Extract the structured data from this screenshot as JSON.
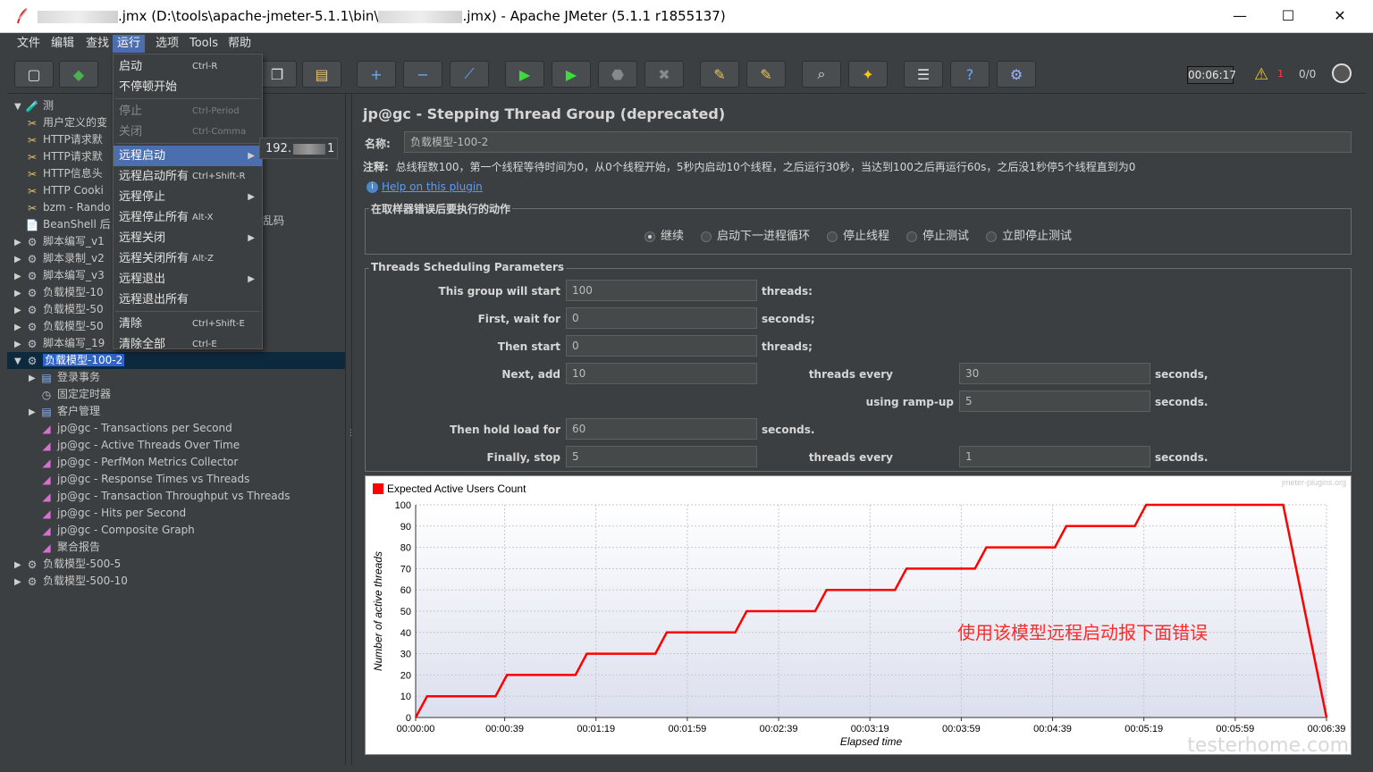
{
  "window": {
    "title_pre": "",
    "title_mid": ".jmx (D:\\tools\\apache-jmeter-5.1.1\\bin\\",
    "title_post": ".jmx) - Apache JMeter (5.1.1 r1855137)",
    "minimize": "—",
    "maximize": "☐",
    "close": "✕"
  },
  "menubar": [
    "文件",
    "编辑",
    "查找",
    "运行",
    "选项",
    "Tools",
    "帮助"
  ],
  "run_menu": [
    {
      "label": "启动",
      "shortcut": "Ctrl-R",
      "disabled": false
    },
    {
      "label": "不停顿开始",
      "shortcut": "",
      "disabled": false
    },
    {
      "label": "停止",
      "shortcut": "Ctrl-Period",
      "disabled": true
    },
    {
      "label": "关闭",
      "shortcut": "Ctrl-Comma",
      "disabled": true
    },
    {
      "label": "远程启动",
      "shortcut": "",
      "disabled": false,
      "submenu": true
    },
    {
      "label": "远程启动所有",
      "shortcut": "Ctrl+Shift-R",
      "disabled": false
    },
    {
      "label": "远程停止",
      "shortcut": "",
      "disabled": false,
      "submenu": true
    },
    {
      "label": "远程停止所有",
      "shortcut": "Alt-X",
      "disabled": false
    },
    {
      "label": "远程关闭",
      "shortcut": "",
      "disabled": false,
      "submenu": true
    },
    {
      "label": "远程关闭所有",
      "shortcut": "Alt-Z",
      "disabled": false
    },
    {
      "label": "远程退出",
      "shortcut": "",
      "disabled": false,
      "submenu": true
    },
    {
      "label": "远程退出所有",
      "shortcut": "",
      "disabled": false
    },
    {
      "label": "清除",
      "shortcut": "Ctrl+Shift-E",
      "disabled": false
    },
    {
      "label": "清除全部",
      "shortcut": "Ctrl-E",
      "disabled": false
    }
  ],
  "submenu": {
    "prefix": "192.",
    "suffix": "1"
  },
  "toolbar": {
    "timer": "00:06:17",
    "warn_count": "1",
    "threads": "0/0"
  },
  "tree": [
    {
      "label": "测",
      "arrow": "▼",
      "icon": "🧪",
      "cls": "ic-doc"
    },
    {
      "label": "用户定义的变",
      "arrow": "",
      "icon": "✂",
      "cls": "ic-wrench"
    },
    {
      "label": "HTTP请求默",
      "arrow": "",
      "icon": "✂",
      "cls": "ic-wrench"
    },
    {
      "label": "HTTP请求默",
      "arrow": "",
      "icon": "✂",
      "cls": "ic-wrench"
    },
    {
      "label": "HTTP信息头",
      "arrow": "",
      "icon": "✂",
      "cls": "ic-wrench"
    },
    {
      "label": "HTTP Cooki",
      "arrow": "",
      "icon": "✂",
      "cls": "ic-wrench"
    },
    {
      "label": "bzm - Rando",
      "arrow": "",
      "icon": "✂",
      "cls": "ic-wrench"
    },
    {
      "label": "BeanShell 后",
      "arrow": "",
      "icon": "📄",
      "cls": "ic-doc"
    },
    {
      "label": "脚本编写_v1",
      "arrow": "▶",
      "icon": "⚙",
      "cls": "ic-gear"
    },
    {
      "label": "脚本录制_v2",
      "arrow": "▶",
      "icon": "⚙",
      "cls": "ic-gear"
    },
    {
      "label": "脚本编写_v3",
      "arrow": "▶",
      "icon": "⚙",
      "cls": "ic-gear"
    },
    {
      "label": "负载模型-10",
      "arrow": "▶",
      "icon": "⚙",
      "cls": "ic-gear"
    },
    {
      "label": "负载模型-50",
      "arrow": "▶",
      "icon": "⚙",
      "cls": "ic-gear"
    },
    {
      "label": "负载模型-50",
      "arrow": "▶",
      "icon": "⚙",
      "cls": "ic-gear"
    },
    {
      "label": "脚本编写_19",
      "arrow": "▶",
      "icon": "⚙",
      "cls": "ic-gear"
    },
    {
      "label": "负载模型-100-2",
      "arrow": "▼",
      "icon": "⚙",
      "cls": "ic-gear",
      "selected": true
    },
    {
      "label": "登录事务",
      "arrow": "▶",
      "icon": "▤",
      "cls": "ic-doc",
      "indent": 1
    },
    {
      "label": "固定定时器",
      "arrow": "",
      "icon": "◷",
      "cls": "ic-gear",
      "indent": 1
    },
    {
      "label": "客户管理",
      "arrow": "▶",
      "icon": "▤",
      "cls": "ic-doc",
      "indent": 1
    },
    {
      "label": "jp@gc - Transactions per Second",
      "arrow": "",
      "icon": "◢",
      "cls": "ic-chart",
      "indent": 1
    },
    {
      "label": "jp@gc - Active Threads Over Time",
      "arrow": "",
      "icon": "◢",
      "cls": "ic-chart",
      "indent": 1
    },
    {
      "label": "jp@gc - PerfMon Metrics Collector",
      "arrow": "",
      "icon": "◢",
      "cls": "ic-chart",
      "indent": 1
    },
    {
      "label": "jp@gc - Response Times vs Threads",
      "arrow": "",
      "icon": "◢",
      "cls": "ic-chart",
      "indent": 1
    },
    {
      "label": "jp@gc - Transaction Throughput vs Threads",
      "arrow": "",
      "icon": "◢",
      "cls": "ic-chart",
      "indent": 1
    },
    {
      "label": "jp@gc - Hits per Second",
      "arrow": "",
      "icon": "◢",
      "cls": "ic-chart",
      "indent": 1
    },
    {
      "label": "jp@gc - Composite Graph",
      "arrow": "",
      "icon": "◢",
      "cls": "ic-chart",
      "indent": 1
    },
    {
      "label": "聚合报告",
      "arrow": "",
      "icon": "◢",
      "cls": "ic-chart",
      "indent": 1
    },
    {
      "label": "负载模型-500-5",
      "arrow": "▶",
      "icon": "⚙",
      "cls": "ic-gear"
    },
    {
      "label": "负载模型-500-10",
      "arrow": "▶",
      "icon": "⚙",
      "cls": "ic-gear"
    }
  ],
  "tree_extra": "乱码",
  "panel": {
    "title": "jp@gc - Stepping Thread Group (deprecated)",
    "name_label": "名称:",
    "name_value": "负载模型-100-2",
    "comment_label": "注释:",
    "comment_value": "总线程数100，第一个线程等待时间为0，从0个线程开始，5秒内启动10个线程，之后运行30秒，当达到100之后再运行60s，之后没1秒停5个线程直到为0",
    "help_icon": "i",
    "help_link": "Help on this plugin",
    "error_action": {
      "legend": "在取样器错误后要执行的动作",
      "options": [
        "继续",
        "启动下一进程循环",
        "停止线程",
        "停止测试",
        "立即停止测试"
      ],
      "selected": 0
    },
    "sched": {
      "legend": "Threads Scheduling Parameters",
      "start_label": "This group will start",
      "start_value": "100",
      "start_unit": "threads:",
      "wait_label": "First, wait for",
      "wait_value": "0",
      "wait_unit": "seconds;",
      "then_label": "Then start",
      "then_value": "0",
      "then_unit": "threads;",
      "next_label": "Next, add",
      "next_value": "10",
      "every_label": "threads every",
      "every_value": "30",
      "every_unit": "seconds,",
      "ramp_label": "using ramp-up",
      "ramp_value": "5",
      "ramp_unit": "seconds.",
      "hold_label": "Then hold load for",
      "hold_value": "60",
      "hold_unit": "seconds.",
      "stop_label": "Finally, stop",
      "stop_value": "5",
      "stop_every_label": "threads every",
      "stop_every_value": "1",
      "stop_every_unit": "seconds."
    }
  },
  "chart_data": {
    "type": "line",
    "legend": "Expected Active Users Count",
    "watermark": "jmeter-plugins.org",
    "ylabel": "Number of active threads",
    "xlabel": "Elapsed time",
    "ylim": [
      0,
      100
    ],
    "yticks": [
      0,
      10,
      20,
      30,
      40,
      50,
      60,
      70,
      80,
      90,
      100
    ],
    "xlim": [
      0,
      399
    ],
    "xticks": [
      {
        "t": 0,
        "label": "00:00:00"
      },
      {
        "t": 39,
        "label": "00:00:39"
      },
      {
        "t": 79,
        "label": "00:01:19"
      },
      {
        "t": 119,
        "label": "00:01:59"
      },
      {
        "t": 159,
        "label": "00:02:39"
      },
      {
        "t": 199,
        "label": "00:03:19"
      },
      {
        "t": 239,
        "label": "00:03:59"
      },
      {
        "t": 279,
        "label": "00:04:39"
      },
      {
        "t": 319,
        "label": "00:05:19"
      },
      {
        "t": 359,
        "label": "00:05:59"
      },
      {
        "t": 399,
        "label": "00:06:39"
      }
    ],
    "series": [
      {
        "color": "#ff0000",
        "points": [
          [
            0,
            0
          ],
          [
            5,
            10
          ],
          [
            35,
            10
          ],
          [
            40,
            20
          ],
          [
            70,
            20
          ],
          [
            75,
            30
          ],
          [
            105,
            30
          ],
          [
            110,
            40
          ],
          [
            140,
            40
          ],
          [
            145,
            50
          ],
          [
            175,
            50
          ],
          [
            180,
            60
          ],
          [
            210,
            60
          ],
          [
            215,
            70
          ],
          [
            245,
            70
          ],
          [
            250,
            80
          ],
          [
            280,
            80
          ],
          [
            285,
            90
          ],
          [
            315,
            90
          ],
          [
            320,
            100
          ],
          [
            380,
            100
          ],
          [
            399,
            0
          ]
        ]
      }
    ],
    "annotation": "使用该模型远程启动报下面错误",
    "annotation_color": "#ff2a2a"
  },
  "corner_watermark": "testerhome.com"
}
